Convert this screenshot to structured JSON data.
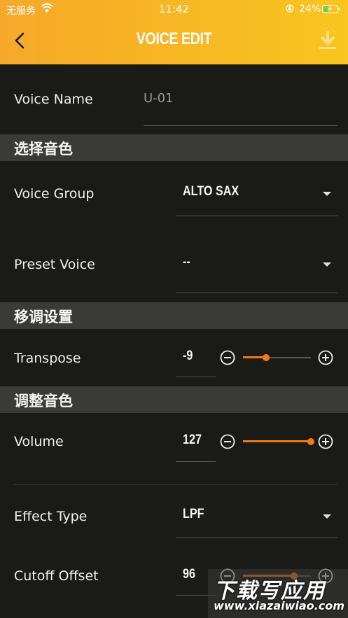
{
  "status_bar": {
    "carrier": "无服务",
    "time": "11:42",
    "battery_percent": "24%"
  },
  "header": {
    "title": "VOICE EDIT",
    "back_icon": "chevron-left-icon",
    "download_icon": "download-icon"
  },
  "voice_name": {
    "label": "Voice Name",
    "placeholder": "U-01"
  },
  "sections": {
    "select_voice": "选择音色",
    "transpose_settings": "移调设置",
    "adjust_voice": "调整音色"
  },
  "voice_group": {
    "label": "Voice Group",
    "value": "ALTO SAX"
  },
  "preset_voice": {
    "label": "Preset Voice",
    "value": "--"
  },
  "transpose": {
    "label": "Transpose",
    "value": "-9",
    "slider_fraction": 0.34
  },
  "volume": {
    "label": "Volume",
    "value": "127",
    "slider_fraction": 1.0
  },
  "effect_type": {
    "label": "Effect Type",
    "value": "LPF"
  },
  "cutoff_offset": {
    "label": "Cutoff Offset",
    "value": "96",
    "slider_fraction": 0.75
  },
  "watermark": {
    "title": "下载写应用",
    "url": "www.xiazaiwiao.com"
  },
  "colors": {
    "accent": "#f07a1a",
    "header_start": "#f6a82a",
    "header_end": "#f9c51f",
    "background": "#1a1a17",
    "section_bar": "#3a3a38"
  }
}
